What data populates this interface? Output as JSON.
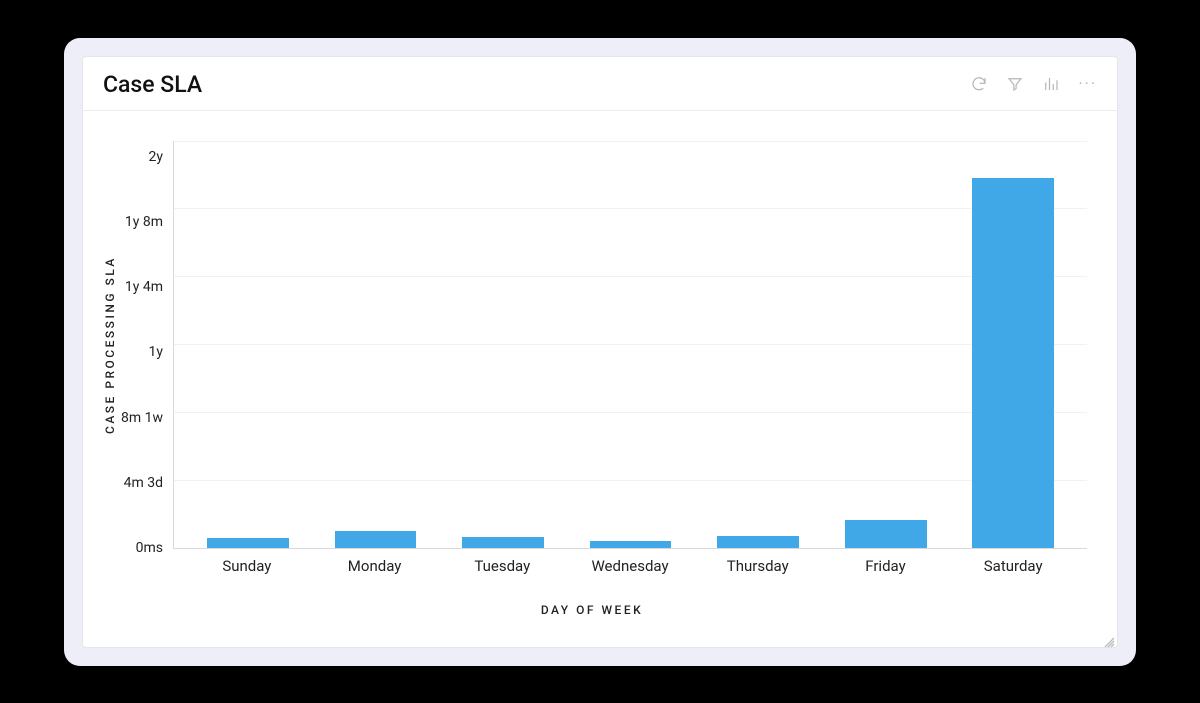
{
  "header": {
    "title": "Case SLA"
  },
  "toolbar": {
    "refresh": "refresh",
    "filter": "filter",
    "chart_type": "chart-type",
    "more": "···"
  },
  "chart_data": {
    "type": "bar",
    "title": "Case SLA",
    "xlabel": "DAY OF WEEK",
    "ylabel": "CASE PROCESSING SLA",
    "categories": [
      "Sunday",
      "Monday",
      "Tuesday",
      "Wednesday",
      "Thursday",
      "Friday",
      "Saturday"
    ],
    "y_ticks": [
      "2y",
      "1y 8m",
      "1y 4m",
      "1y",
      "8m 1w",
      "4m 3d",
      "0ms"
    ],
    "values_months": [
      0.55,
      0.95,
      0.6,
      0.4,
      0.7,
      1.6,
      21.8
    ],
    "ylim_months": [
      0,
      24
    ],
    "bar_color": "#41a8e8"
  }
}
